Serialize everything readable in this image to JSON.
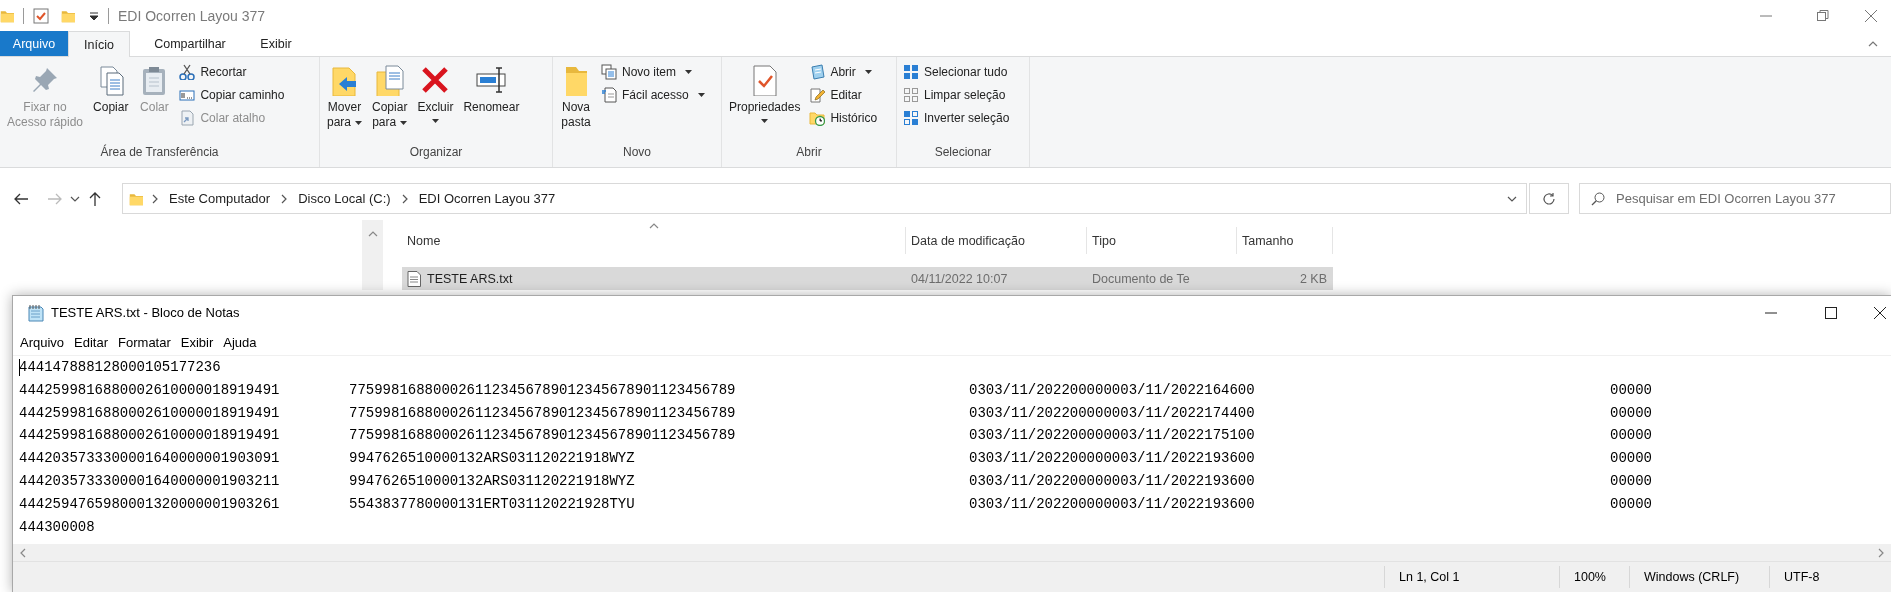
{
  "explorer": {
    "title": "EDI Ocorren Layou 377",
    "tabs": [
      {
        "label": "Arquivo",
        "kind": "file",
        "selected": false
      },
      {
        "label": "Início",
        "kind": "tab",
        "selected": true
      },
      {
        "label": "Compartilhar",
        "kind": "tab",
        "selected": false
      },
      {
        "label": "Exibir",
        "kind": "tab",
        "selected": false
      }
    ],
    "ribbon": [
      {
        "name": "Área de Transferência",
        "items": [
          {
            "label": "Fixar no\nAcesso rápido",
            "kind": "large",
            "disabled": true,
            "dropdown": false
          },
          {
            "label": "Copiar",
            "kind": "large",
            "disabled": false,
            "dropdown": false
          },
          {
            "label": "Colar",
            "kind": "large",
            "disabled": true,
            "dropdown": false
          },
          {
            "label": "Recortar",
            "kind": "small",
            "disabled": false,
            "dropdown": false
          },
          {
            "label": "Copiar caminho",
            "kind": "small",
            "disabled": false,
            "dropdown": false
          },
          {
            "label": "Colar atalho",
            "kind": "small",
            "disabled": true,
            "dropdown": false
          }
        ]
      },
      {
        "name": "Organizar",
        "items": [
          {
            "label": "Mover\npara",
            "kind": "large",
            "disabled": false,
            "dropdown": true
          },
          {
            "label": "Copiar\npara",
            "kind": "large",
            "disabled": false,
            "dropdown": true
          },
          {
            "label": "Excluir",
            "kind": "large",
            "disabled": false,
            "dropdown": true
          },
          {
            "label": "Renomear",
            "kind": "large",
            "disabled": false,
            "dropdown": false
          }
        ]
      },
      {
        "name": "Novo",
        "items": [
          {
            "label": "Nova\npasta",
            "kind": "large",
            "disabled": false,
            "dropdown": false
          },
          {
            "label": "Novo item",
            "kind": "small",
            "disabled": false,
            "dropdown": true
          },
          {
            "label": "Fácil acesso",
            "kind": "small",
            "disabled": false,
            "dropdown": true
          }
        ]
      },
      {
        "name": "Abrir",
        "items": [
          {
            "label": "Propriedades",
            "kind": "large",
            "disabled": false,
            "dropdown": true
          },
          {
            "label": "Abrir",
            "kind": "small",
            "disabled": false,
            "dropdown": true
          },
          {
            "label": "Editar",
            "kind": "small",
            "disabled": false,
            "dropdown": false
          },
          {
            "label": "Histórico",
            "kind": "small",
            "disabled": false,
            "dropdown": false
          }
        ]
      },
      {
        "name": "Selecionar",
        "items": [
          {
            "label": "Selecionar tudo",
            "kind": "small",
            "disabled": false,
            "dropdown": false
          },
          {
            "label": "Limpar seleção",
            "kind": "small",
            "disabled": false,
            "dropdown": false
          },
          {
            "label": "Inverter seleção",
            "kind": "small",
            "disabled": false,
            "dropdown": false
          }
        ]
      }
    ],
    "navigation": {
      "back": {
        "disabled": false
      },
      "forward": {
        "disabled": true
      }
    },
    "breadcrumbs": [
      "Este Computador",
      "Disco Local (C:)",
      "EDI Ocorren Layou 377"
    ],
    "search": {
      "placeholder": "Pesquisar em EDI Ocorren Layou 377"
    },
    "file_list": {
      "columns": [
        "Nome",
        "Data de modificação",
        "Tipo",
        "Tamanho"
      ],
      "rows": [
        {
          "cells": [
            "TESTE ARS.txt",
            "04/11/2022 10:07",
            "Documento de Te",
            "2 KB"
          ],
          "selected": true
        }
      ]
    }
  },
  "notepad": {
    "title": "TESTE ARS.txt - Bloco de Notas",
    "menu": [
      "Arquivo",
      "Editar",
      "Formatar",
      "Exibir",
      "Ajuda"
    ],
    "lines": [
      [
        "444147888128000105177236"
      ],
      [
        "4442599816880002610000018919491",
        "7759981688000261123456789012345678901123456789",
        "0303/11/202200000003/11/2022164600",
        "00000"
      ],
      [
        "4442599816880002610000018919491",
        "7759981688000261123456789012345678901123456789",
        "0303/11/202200000003/11/2022174400",
        "00000"
      ],
      [
        "4442599816880002610000018919491",
        "7759981688000261123456789012345678901123456789",
        "0303/11/202200000003/11/2022175100",
        "00000"
      ],
      [
        "4442035733300001640000001903091",
        "9947626510000132ARS031120221918WYZ",
        "0303/11/202200000003/11/2022193600",
        "00000"
      ],
      [
        "4442035733300001640000001903211",
        "9947626510000132ARS031120221918WYZ",
        "0303/11/202200000003/11/2022193600",
        "00000"
      ],
      [
        "4442594765980001320000001903261",
        "5543837780000131ERT031120221928TYU",
        "0303/11/202200000003/11/2022193600",
        "00000"
      ],
      [
        "444300008"
      ]
    ],
    "status_bar": [
      "Ln 1, Col 1",
      "100%",
      "Windows (CRLF)",
      "UTF-8"
    ]
  }
}
